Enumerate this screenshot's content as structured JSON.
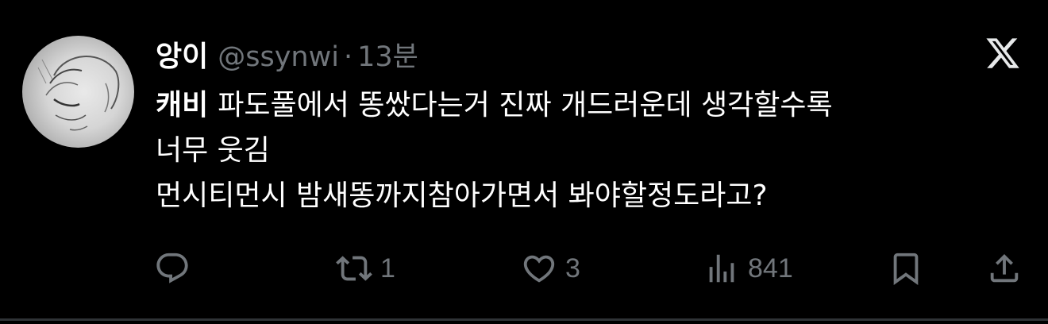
{
  "tweet": {
    "display_name": "앙이",
    "handle": "@ssynwi",
    "separator": "·",
    "time": "13분",
    "body": {
      "bold_word": "캐비",
      "line1_rest": "파도풀에서 똥쌌다는거 진짜 개드러운데 생각할수록",
      "line2": "너무 웃김",
      "line3": "먼시티먼시 밤새똥까지참아가면서 봐야할정도라고?"
    }
  },
  "actions": {
    "reply": {
      "icon": "reply-icon",
      "count": ""
    },
    "retweet": {
      "icon": "retweet-icon",
      "count": "1"
    },
    "like": {
      "icon": "heart-icon",
      "count": "3"
    },
    "views": {
      "icon": "views-icon",
      "count": "841"
    },
    "bookmark": {
      "icon": "bookmark-icon"
    },
    "share": {
      "icon": "share-icon"
    }
  },
  "brand": {
    "logo": "x-logo-icon"
  },
  "colors": {
    "background": "#000000",
    "text": "#ffffff",
    "muted": "#71767b",
    "divider": "#2f3336"
  }
}
